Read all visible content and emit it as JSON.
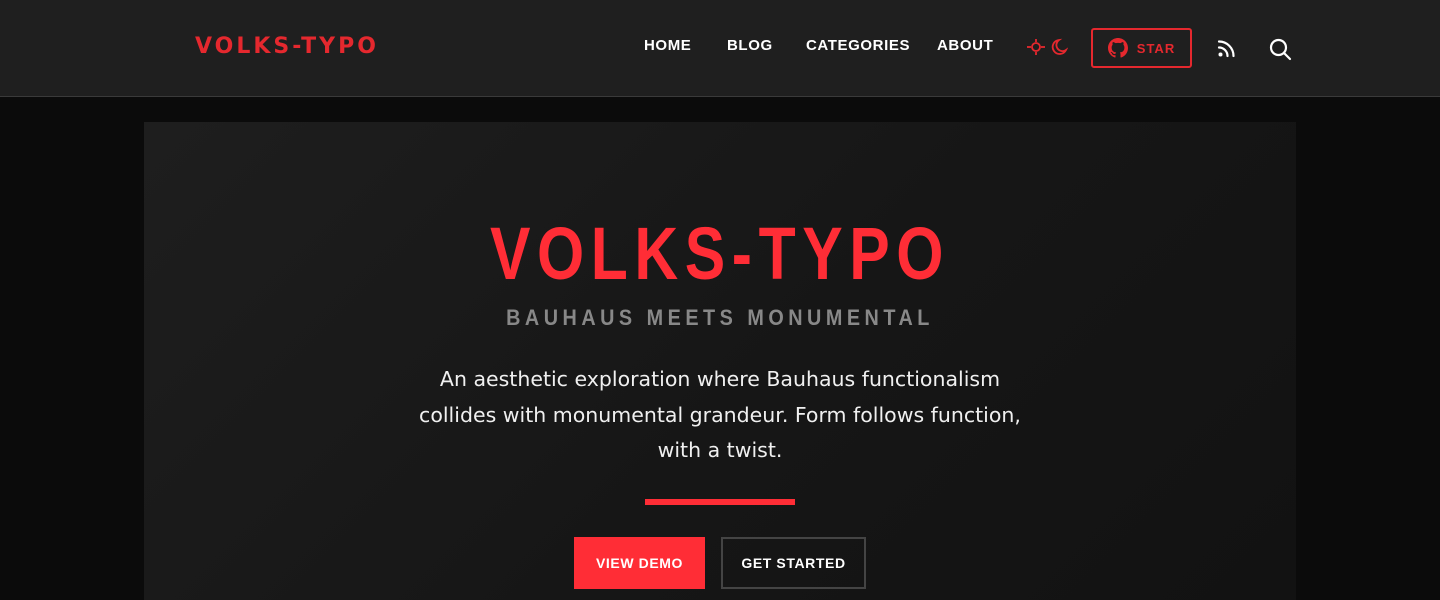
{
  "header": {
    "logo": "VOLKS-TYPO",
    "nav": [
      {
        "label": "HOME"
      },
      {
        "label": "BLOG"
      },
      {
        "label": "CATEGORIES"
      },
      {
        "label": "ABOUT"
      }
    ],
    "star_label": "STAR",
    "icons": {
      "theme": "sun-moon-icon",
      "github": "github-icon",
      "rss": "rss-icon",
      "search": "search-icon"
    }
  },
  "hero": {
    "title": "VOLKS-TYPO",
    "subtitle": "BAUHAUS MEETS MONUMENTAL",
    "description": "An aesthetic exploration where Bauhaus functionalism collides with monumental grandeur. Form follows function, with a twist.",
    "primary_button": "VIEW DEMO",
    "secondary_button": "GET STARTED"
  },
  "colors": {
    "accent": "#ff2d36",
    "logo_red": "#e5282e",
    "header_bg": "#1f1f1f",
    "page_bg": "#0b0b0b",
    "subtitle_gray": "#888888"
  }
}
